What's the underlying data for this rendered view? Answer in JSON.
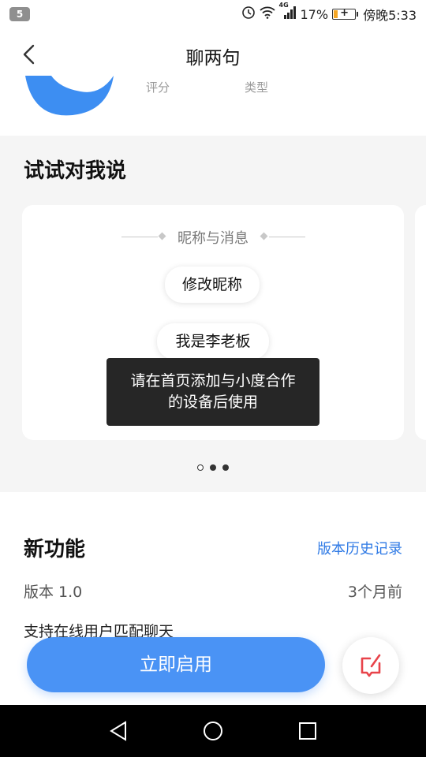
{
  "status_bar": {
    "notification_count": "5",
    "battery_percent": "17%",
    "time": "傍晚5:33",
    "network_label": "4G",
    "icons": [
      "alarm-icon",
      "wifi-icon",
      "signal-icon",
      "battery-charging-icon"
    ]
  },
  "header": {
    "title": "聊两句"
  },
  "info": {
    "rating_label": "评分",
    "type_label": "类型"
  },
  "try_section": {
    "title": "试试对我说",
    "card": {
      "heading": "昵称与消息",
      "chips": [
        "修改昵称",
        "我是李老板"
      ]
    },
    "pager": {
      "count": 3,
      "active_index": 0
    }
  },
  "toast": {
    "line1": "请在首页添加与小度合作",
    "line2": "的设备后使用"
  },
  "new_features": {
    "title": "新功能",
    "history_link": "版本历史记录",
    "version": "版本 1.0",
    "version_time": "3个月前",
    "description_partial": "支持在线用户匹配聊天"
  },
  "actions": {
    "enable_label": "立即启用",
    "feedback_icon": "feedback-icon"
  },
  "colors": {
    "accent": "#4a93f5",
    "link": "#2f7ae5",
    "feedback_red": "#e8434a",
    "section_bg": "#f5f5f5",
    "toast_bg": "#262626"
  }
}
